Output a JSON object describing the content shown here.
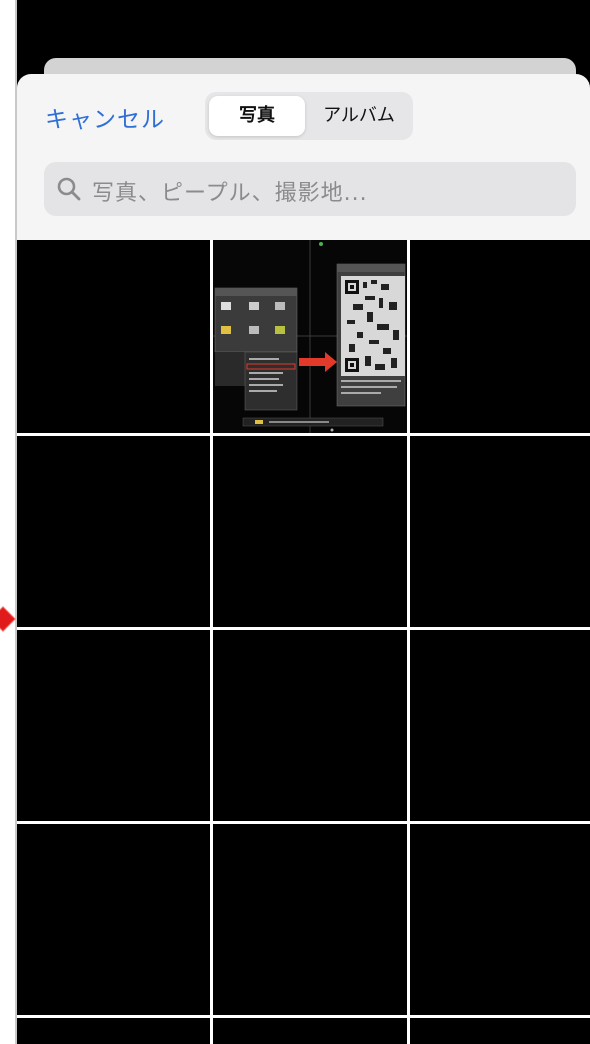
{
  "header": {
    "cancel_label": "キャンセル",
    "tabs": [
      {
        "label": "写真",
        "selected": true
      },
      {
        "label": "アルバム",
        "selected": false
      }
    ]
  },
  "search": {
    "placeholder": "写真、ピープル、撮影地..."
  },
  "colors": {
    "accent": "#2f6fd6",
    "sheet_background": "#f5f5f5",
    "grid_background": "#000000"
  },
  "grid": {
    "columns": 3,
    "thumbnails": [
      {
        "position": 2,
        "kind": "dvr-menu-screenshot-with-qr-code"
      }
    ]
  }
}
